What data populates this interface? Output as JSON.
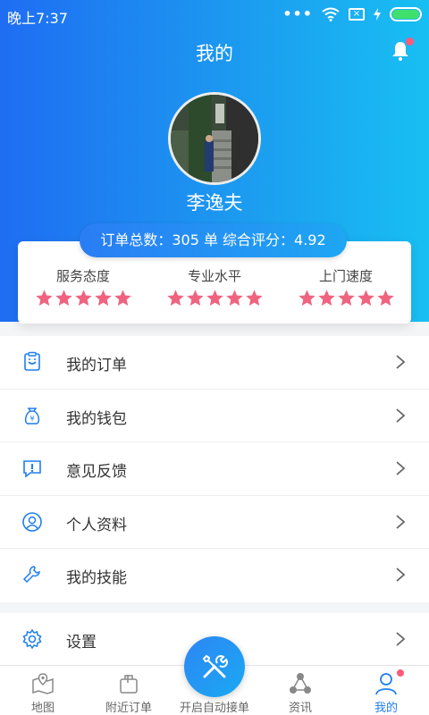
{
  "status_bar": {
    "time": "晚上7:37",
    "dots": "•••"
  },
  "header": {
    "title": "我的"
  },
  "profile": {
    "name": "李逸夫"
  },
  "summary": {
    "text": "订单总数：305 单   综合评分：4.92",
    "order_count": 305,
    "score": 4.92
  },
  "ratings": [
    {
      "label": "服务态度",
      "stars": 5
    },
    {
      "label": "专业水平",
      "stars": 5
    },
    {
      "label": "上门速度",
      "stars": 5
    }
  ],
  "menu": [
    {
      "label": "我的订单",
      "icon": "order-icon"
    },
    {
      "label": "我的钱包",
      "icon": "wallet-icon"
    },
    {
      "label": "意见反馈",
      "icon": "feedback-icon"
    },
    {
      "label": "个人资料",
      "icon": "profile-icon"
    },
    {
      "label": "我的技能",
      "icon": "wrench-icon"
    }
  ],
  "settings": {
    "label": "设置",
    "icon": "gear-icon"
  },
  "tabs": [
    {
      "label": "地图",
      "icon": "map-icon"
    },
    {
      "label": "附近订单",
      "icon": "bag-icon"
    },
    {
      "label": "开启自动接单",
      "icon": "tools-icon"
    },
    {
      "label": "资讯",
      "icon": "share-icon"
    },
    {
      "label": "我的",
      "icon": "user-icon",
      "active": true
    }
  ],
  "colors": {
    "primary": "#1e7ef0",
    "star": "#f0637f",
    "badge": "#ff5a7a"
  }
}
